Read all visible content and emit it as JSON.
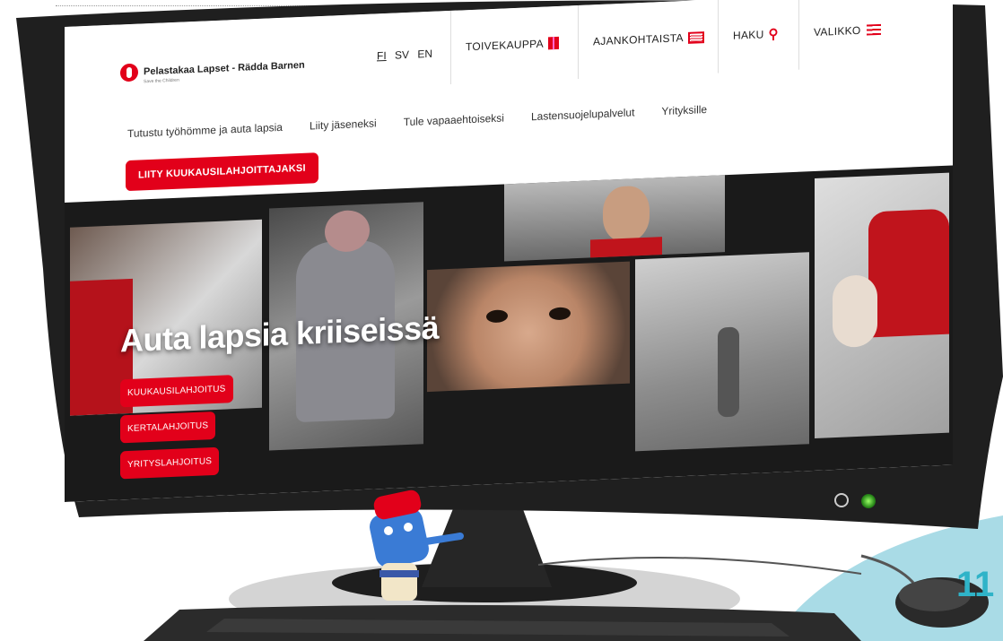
{
  "site": {
    "logo_text": "Pelastakaa Lapset - Rädda Barnen",
    "logo_sub": "Save the Children"
  },
  "header": {
    "languages": [
      "FI",
      "SV",
      "EN"
    ],
    "active_language": "FI",
    "nav": [
      {
        "label": "TOIVEKAUPPA",
        "icon": "gift-icon"
      },
      {
        "label": "AJANKOHTAISTA",
        "icon": "news-icon"
      },
      {
        "label": "HAKU",
        "icon": "search-icon"
      },
      {
        "label": "VALIKKO",
        "icon": "menu-icon"
      }
    ]
  },
  "subnav": [
    "Tutustu työhömme ja auta lapsia",
    "Liity jäseneksi",
    "Tule vapaaehtoiseksi",
    "Lastensuojelupalvelut",
    "Yrityksille"
  ],
  "cta_label": "LIITY KUUKAUSILAHJOITTAJAKSI",
  "hero": {
    "headline": "Auta lapsia kriiseissä",
    "buttons": [
      "KUUKAUSILAHJOITUS",
      "KERTALAHJOITUS",
      "YRITYSLAHJOITUS"
    ]
  },
  "page_badge": "11",
  "colors": {
    "brand_red": "#e2001a",
    "monitor": "#1f1f1f",
    "accent_blue": "#a9dbe6"
  }
}
